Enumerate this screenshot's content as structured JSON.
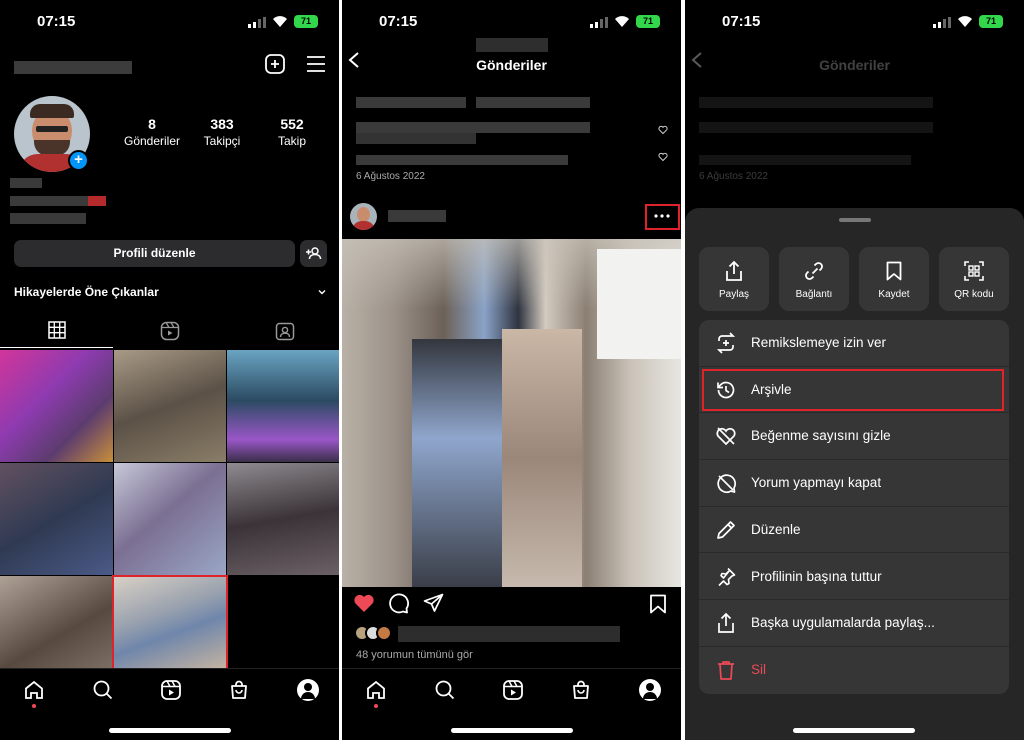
{
  "status": {
    "time": "07:15",
    "battery": "71"
  },
  "profile": {
    "stats": [
      {
        "value": "8",
        "label": "Gönderiler"
      },
      {
        "value": "383",
        "label": "Takipçi"
      },
      {
        "value": "552",
        "label": "Takip"
      }
    ],
    "edit_label": "Profili düzenle",
    "highlights_label": "Hikayelerde Öne Çıkanlar"
  },
  "posts": {
    "title": "Gönderiler",
    "date": "6 Ağustos 2022",
    "comments_label": "48 yorumun tümünü gör"
  },
  "sheet": {
    "quick": [
      {
        "label": "Paylaş",
        "icon": "share-icon"
      },
      {
        "label": "Bağlantı",
        "icon": "link-icon"
      },
      {
        "label": "Kaydet",
        "icon": "bookmark-icon"
      },
      {
        "label": "QR kodu",
        "icon": "qr-code-icon"
      }
    ],
    "items": [
      {
        "label": "Remikslemeye izin ver",
        "icon": "remix-icon"
      },
      {
        "label": "Arşivle",
        "icon": "archive-icon"
      },
      {
        "label": "Beğenme sayısını gizle",
        "icon": "hide-likes-icon"
      },
      {
        "label": "Yorum yapmayı kapat",
        "icon": "comments-off-icon"
      },
      {
        "label": "Düzenle",
        "icon": "edit-icon"
      },
      {
        "label": "Profilinin başına tuttur",
        "icon": "pin-icon"
      },
      {
        "label": "Başka uygulamalarda paylaş...",
        "icon": "share-external-icon"
      },
      {
        "label": "Sil",
        "icon": "trash-icon",
        "color": "#ed4956"
      }
    ]
  },
  "colors": {
    "highlight": "#e0222a",
    "accent": "#0095f6",
    "like": "#ed4956",
    "battery": "#32d74b"
  }
}
